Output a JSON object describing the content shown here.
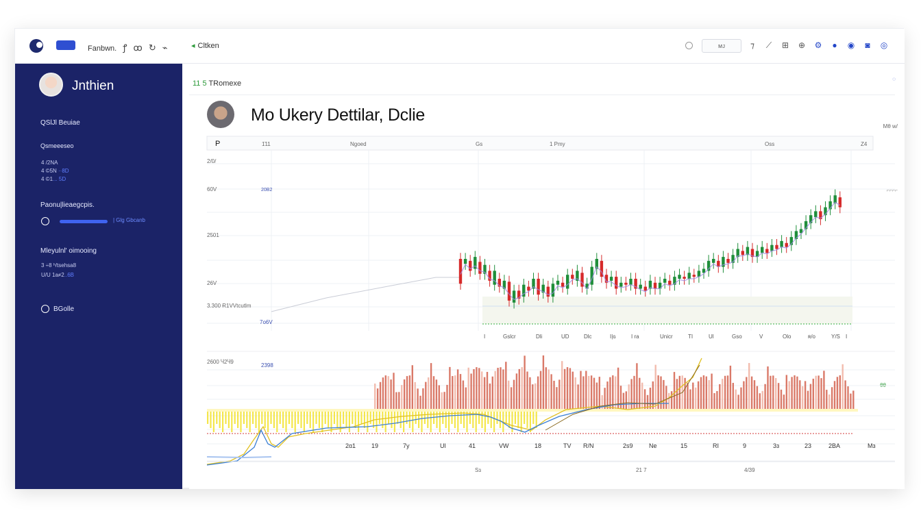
{
  "topbar": {
    "pill_label": "",
    "nav_text": "Fanbwn.",
    "nav_icons": [
      "leaf-icon",
      "shuffle-icon",
      "refresh-icon",
      "link-icon"
    ],
    "crumb_text": "Cltken",
    "search_value": "ᴍᴊ",
    "icons": [
      "arrow-icon",
      "pen-icon",
      "share-icon",
      "globe-icon",
      "settings-icon",
      "record-icon",
      "circle-icon",
      "copy-icon",
      "help-icon"
    ]
  },
  "sidebar": {
    "user_name": "Jnthien",
    "section1": "QSlJl Beuiae",
    "section1_sub": "Qsmeeeseo",
    "section1_items": [
      {
        "a": "4 /2NA",
        "b": ""
      },
      {
        "a": "4 ©5N ",
        "b": "··8D"
      },
      {
        "a": "4 ©1",
        "b": "... 5D"
      }
    ],
    "section2": "Paonu|lieaegcpis.",
    "section2_slider_label": "| Glg Gbcanb",
    "section3": "Mleyulnl' oimooing",
    "section3_items": [
      {
        "a": "3 ÷8 ʰ/tsehsa8",
        "b": ""
      },
      {
        "a": "U/U 1a≠2",
        "b": "..6B"
      }
    ],
    "radio_label": "BGolle"
  },
  "main": {
    "crumb_prefix": "11 5",
    "crumb": " TRomexe",
    "title": "Mo Ukery Dettilar, Dclie",
    "side_note": "Mθ w/",
    "side_tag": "⌐⌐⌐⌐",
    "side_green": "θθ"
  },
  "chart_data": {
    "type": "candlestick",
    "top_header": [
      "P",
      "1̈11",
      "Ngoed",
      "Gs",
      "1 Pmy",
      "Oss",
      "Z4"
    ],
    "y_ticks": [
      "2/0/",
      "60V",
      "2501",
      "26V",
      "3.300 Ɍ1VVtcutlm",
      "7o6V"
    ],
    "inner_ticks": [
      "20B2"
    ],
    "x_ticks_top": [
      "I",
      "Gslcr",
      "Dli",
      "UD",
      "Dlc",
      "I|ɢ",
      "I ra",
      "Unicr",
      "TI",
      "Ul",
      "Gso",
      "V",
      "Olo",
      "ʀ/o",
      "Y/S",
      "I"
    ],
    "candles": [
      [
        0,
        60,
        35
      ],
      [
        1,
        55,
        60
      ],
      [
        2,
        58,
        48
      ],
      [
        3,
        50,
        62
      ],
      [
        4,
        57,
        45
      ],
      [
        5,
        45,
        54
      ],
      [
        6,
        48,
        38
      ],
      [
        7,
        34,
        48
      ],
      [
        8,
        40,
        32
      ],
      [
        9,
        30,
        38
      ],
      [
        10,
        37,
        18
      ],
      [
        11,
        16,
        28
      ],
      [
        12,
        28,
        20
      ],
      [
        13,
        22,
        34
      ],
      [
        14,
        32,
        28
      ],
      [
        15,
        30,
        40
      ],
      [
        16,
        40,
        24
      ],
      [
        17,
        26,
        34
      ],
      [
        18,
        32,
        22
      ],
      [
        19,
        22,
        35
      ],
      [
        20,
        34,
        38
      ],
      [
        21,
        36,
        32
      ],
      [
        22,
        30,
        44
      ],
      [
        23,
        44,
        40
      ],
      [
        24,
        38,
        48
      ],
      [
        25,
        46,
        32
      ],
      [
        26,
        30,
        35
      ],
      [
        27,
        34,
        52
      ],
      [
        28,
        50,
        60
      ],
      [
        29,
        58,
        42
      ],
      [
        30,
        44,
        36
      ],
      [
        31,
        38,
        42
      ],
      [
        32,
        42,
        30
      ],
      [
        33,
        32,
        36
      ],
      [
        34,
        36,
        34
      ],
      [
        35,
        34,
        40
      ],
      [
        36,
        40,
        30
      ],
      [
        37,
        30,
        34
      ],
      [
        38,
        32,
        28
      ],
      [
        39,
        30,
        38
      ],
      [
        40,
        36,
        30
      ],
      [
        41,
        30,
        36
      ],
      [
        42,
        36,
        40
      ],
      [
        43,
        38,
        34
      ],
      [
        44,
        34,
        42
      ],
      [
        45,
        40,
        44
      ],
      [
        46,
        42,
        40
      ],
      [
        47,
        40,
        46
      ],
      [
        48,
        44,
        42
      ],
      [
        49,
        42,
        48
      ],
      [
        50,
        46,
        50
      ],
      [
        51,
        48,
        58
      ],
      [
        52,
        56,
        60
      ],
      [
        53,
        58,
        52
      ],
      [
        54,
        52,
        62
      ],
      [
        55,
        60,
        56
      ],
      [
        56,
        56,
        64
      ],
      [
        57,
        62,
        70
      ],
      [
        58,
        68,
        64
      ],
      [
        59,
        64,
        72
      ],
      [
        60,
        70,
        62
      ],
      [
        61,
        62,
        68
      ],
      [
        62,
        66,
        72
      ],
      [
        63,
        70,
        66
      ],
      [
        64,
        68,
        74
      ],
      [
        65,
        74,
        70
      ],
      [
        66,
        72,
        78
      ],
      [
        67,
        76,
        72
      ],
      [
        68,
        74,
        82
      ],
      [
        69,
        80,
        88
      ],
      [
        70,
        86,
        90
      ],
      [
        71,
        90,
        98
      ],
      [
        72,
        96,
        104
      ],
      [
        73,
        102,
        108
      ],
      [
        74,
        108,
        100
      ],
      [
        75,
        104,
        112
      ],
      [
        76,
        110,
        118
      ],
      [
        77,
        116,
        124
      ],
      [
        78,
        122,
        112
      ]
    ],
    "bottom_y_ticks": [
      "2600 Ⴗ2Ⴗ9",
      "2398"
    ],
    "x_ticks_bottom": [
      "2ɑ1",
      "19",
      "7y",
      "Ul",
      "41",
      "VW",
      "18",
      "TV",
      "R/N",
      "2s9",
      "Ne",
      "15",
      "RI",
      "9",
      "3ɜ",
      "23",
      "2BA",
      "Mɜ"
    ],
    "x_labels_footer": [
      "Sɜ",
      "21 7",
      "4/39"
    ]
  }
}
